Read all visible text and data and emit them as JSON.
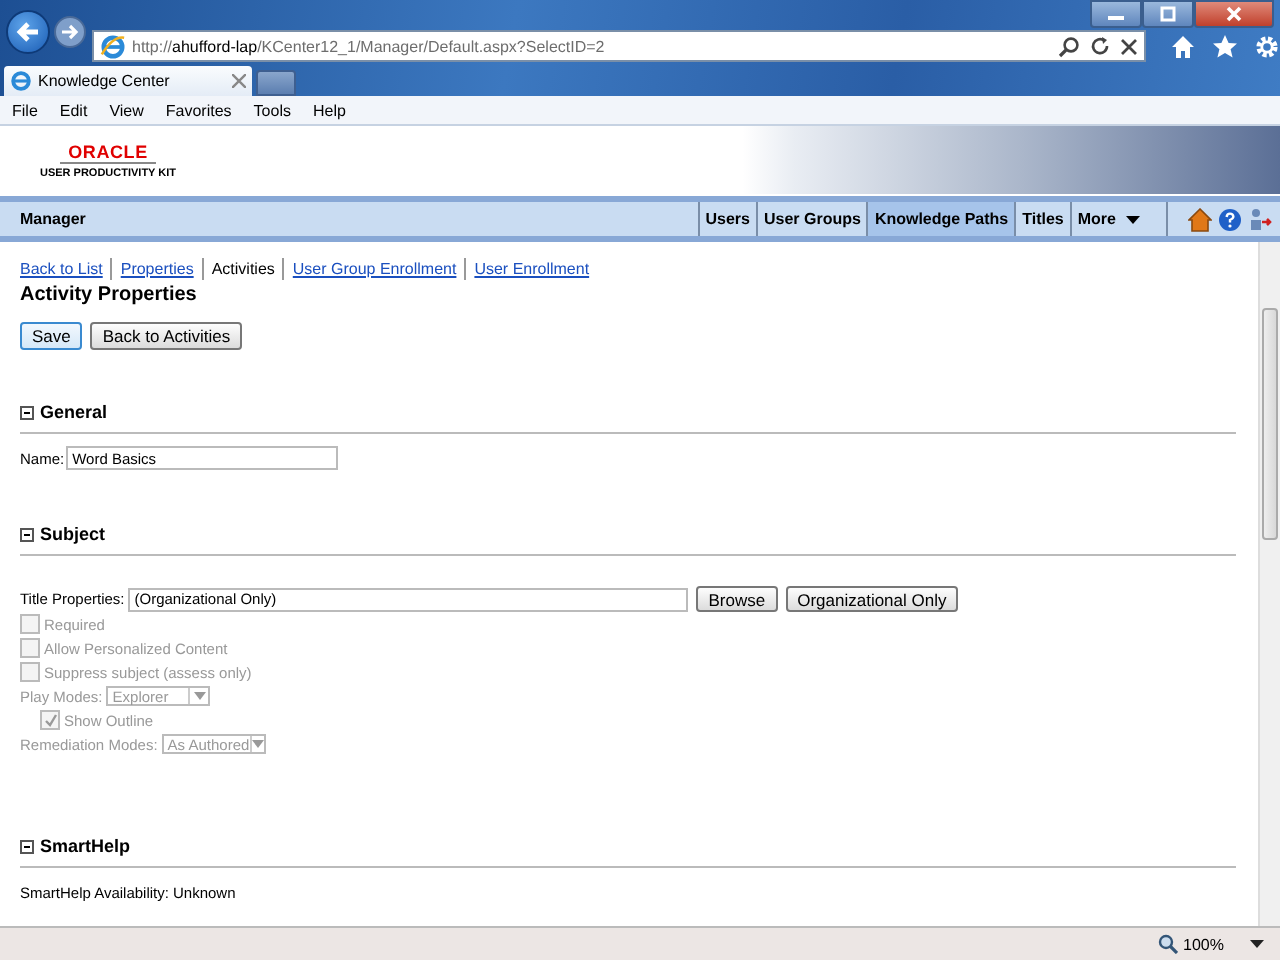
{
  "browser": {
    "url": "http://**ahufford-lap**/KCenter12_1/Manager/Default.aspx?SelectID=2",
    "tab": "Knowledge Center",
    "menu": [
      "File",
      "Edit",
      "View",
      "Favorites",
      "Tools",
      "Help"
    ],
    "zoom": "100%"
  },
  "header": {
    "logo": "ORACLE",
    "product": "USER PRODUCTIVITY KIT"
  },
  "navbar": {
    "title": "Manager",
    "items": [
      {
        "label": "Users",
        "selected": false
      },
      {
        "label": "User Groups",
        "selected": false
      },
      {
        "label": "Knowledge Paths",
        "selected": true
      },
      {
        "label": "Titles",
        "selected": false
      },
      {
        "label": "More",
        "selected": false
      }
    ]
  },
  "subtabs": [
    {
      "label": "Back to List",
      "selected": false
    },
    {
      "label": "Properties",
      "selected": false
    },
    {
      "label": "Activities",
      "selected": true
    },
    {
      "label": "User Group Enrollment",
      "selected": false
    },
    {
      "label": "User Enrollment",
      "selected": false
    }
  ],
  "heading": "Activity Properties",
  "buttons": [
    "Save",
    "Back to Activities"
  ],
  "general": {
    "title": "General",
    "expanded": true,
    "name_label": "Name:",
    "name_value": "Word Basics"
  },
  "subject": {
    "title": "Subject",
    "expanded": true,
    "title_label": "Title Properties:",
    "title_value": "(Organizational Only)",
    "buttons": [
      "Browse",
      "Organizational Only"
    ],
    "options": [
      {
        "kind": "checkbox",
        "label": "Required",
        "checked": false,
        "disabled": true
      },
      {
        "kind": "checkbox",
        "label": "Allow Personalized Content",
        "checked": false,
        "disabled": true
      },
      {
        "kind": "checkbox",
        "label": "Suppress subject (assess only)",
        "checked": false,
        "disabled": true
      },
      {
        "kind": "select",
        "label": "Play Modes:",
        "value": "Explorer",
        "disabled": true
      },
      {
        "kind": "subcheckbox",
        "label": "Show Outline",
        "checked": true,
        "disabled": true
      },
      {
        "kind": "select",
        "label": "Remediation Modes:",
        "value": "As Authored",
        "disabled": true
      }
    ]
  },
  "smarthelp": {
    "title": "SmartHelp",
    "expanded": true,
    "label": "SmartHelp Availability:",
    "value": "Unknown"
  }
}
